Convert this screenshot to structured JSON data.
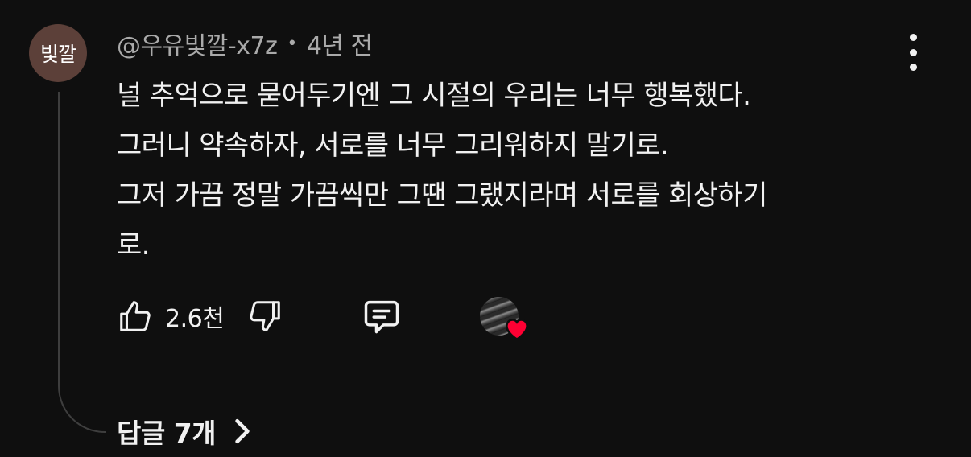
{
  "comment": {
    "avatar_text": "빛깔",
    "author": "@우유빛깔-x7z",
    "separator": "•",
    "time": "4년 전",
    "lines": [
      "널 추억으로 묻어두기엔 그 시절의 우리는 너무 행복했다.",
      "그러니 약속하자, 서로를 너무 그리워하지 말기로.",
      "그저 가끔 정말 가끔씩만 그땐 그랬지라며 서로를 회상하기",
      "로."
    ],
    "like_count": "2.6천",
    "replies_label": "답글 7개"
  },
  "colors": {
    "background": "#0f0f0f",
    "text_primary": "#f1f1f1",
    "text_secondary": "#aaaaaa",
    "avatar_bg": "#5c4039",
    "heart": "#ff0033"
  },
  "icons": {
    "like": "thumb-up-icon",
    "dislike": "thumb-down-icon",
    "reply": "comment-icon",
    "more": "more-vert-icon",
    "creator_heart": "heart-icon",
    "replies_chevron": "chevron-right-icon"
  }
}
